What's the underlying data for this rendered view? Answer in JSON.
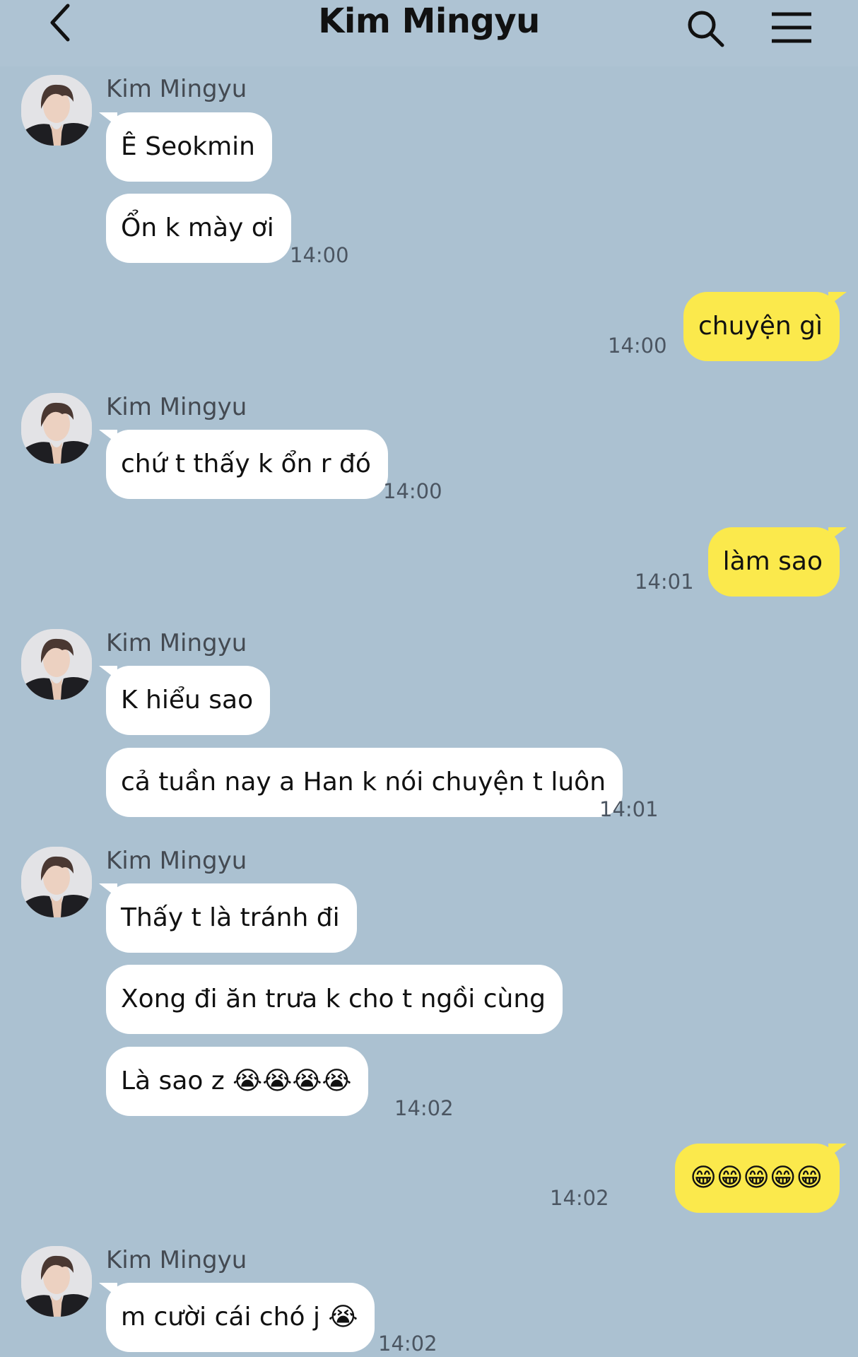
{
  "header": {
    "title": "Kim Mingyu"
  },
  "messages": [
    {
      "sender": "Kim Mingyu",
      "text": "Ê Seokmin"
    },
    {
      "text": "Ổn k mày ơi",
      "time": "14:00"
    },
    {
      "text": "chuyện gì",
      "time": "14:00"
    },
    {
      "sender": "Kim Mingyu",
      "text": "chứ t thấy k ổn r đó",
      "time": "14:00"
    },
    {
      "text": "làm sao",
      "time": "14:01"
    },
    {
      "sender": "Kim Mingyu",
      "text": "K hiểu sao"
    },
    {
      "text": "cả tuần nay a Han k nói chuyện t luôn",
      "time": "14:01"
    },
    {
      "sender": "Kim Mingyu",
      "text": "Thấy t là tránh đi"
    },
    {
      "text": "Xong đi ăn trưa k cho t ngồi cùng"
    },
    {
      "text": "Là sao z 😭😭😭😭",
      "time": "14:02"
    },
    {
      "text": "😁😁😁😁😁",
      "time": "14:02"
    },
    {
      "sender": "Kim Mingyu",
      "text": "m cười cái chó j 😭",
      "time": "14:02"
    }
  ],
  "colors": {
    "background": "#abc1d1",
    "incoming_bubble": "#ffffff",
    "outgoing_bubble": "#fbe94c"
  }
}
